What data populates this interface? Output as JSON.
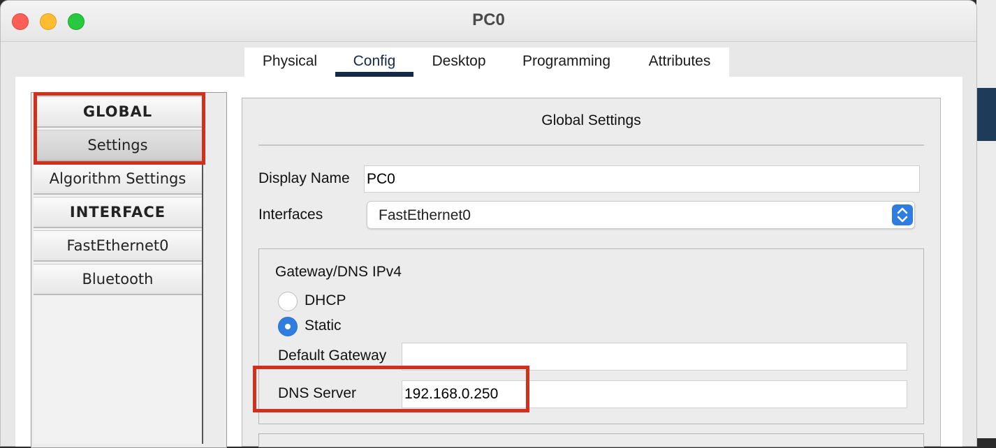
{
  "window": {
    "title": "PC0"
  },
  "tabs": [
    {
      "label": "Physical"
    },
    {
      "label": "Config"
    },
    {
      "label": "Desktop"
    },
    {
      "label": "Programming"
    },
    {
      "label": "Attributes"
    }
  ],
  "active_tab": "Config",
  "sidebar": {
    "items": [
      {
        "label": "GLOBAL"
      },
      {
        "label": "Settings"
      },
      {
        "label": "Algorithm Settings"
      },
      {
        "label": "INTERFACE"
      },
      {
        "label": "FastEthernet0"
      },
      {
        "label": "Bluetooth"
      }
    ]
  },
  "panel": {
    "title": "Global Settings",
    "display_name_label": "Display Name",
    "display_name_value": "PC0",
    "interfaces_label": "Interfaces",
    "interfaces_value": "FastEthernet0",
    "gateway_section": {
      "title": "Gateway/DNS IPv4",
      "dhcp_label": "DHCP",
      "static_label": "Static",
      "selected_mode": "Static",
      "default_gateway_label": "Default Gateway",
      "default_gateway_value": "",
      "dns_server_label": "DNS Server",
      "dns_server_value": "192.168.0.250"
    }
  },
  "colors": {
    "highlight": "#d0301c",
    "accent_blue": "#2f7de1",
    "active_tab_underline": "#14294a"
  }
}
